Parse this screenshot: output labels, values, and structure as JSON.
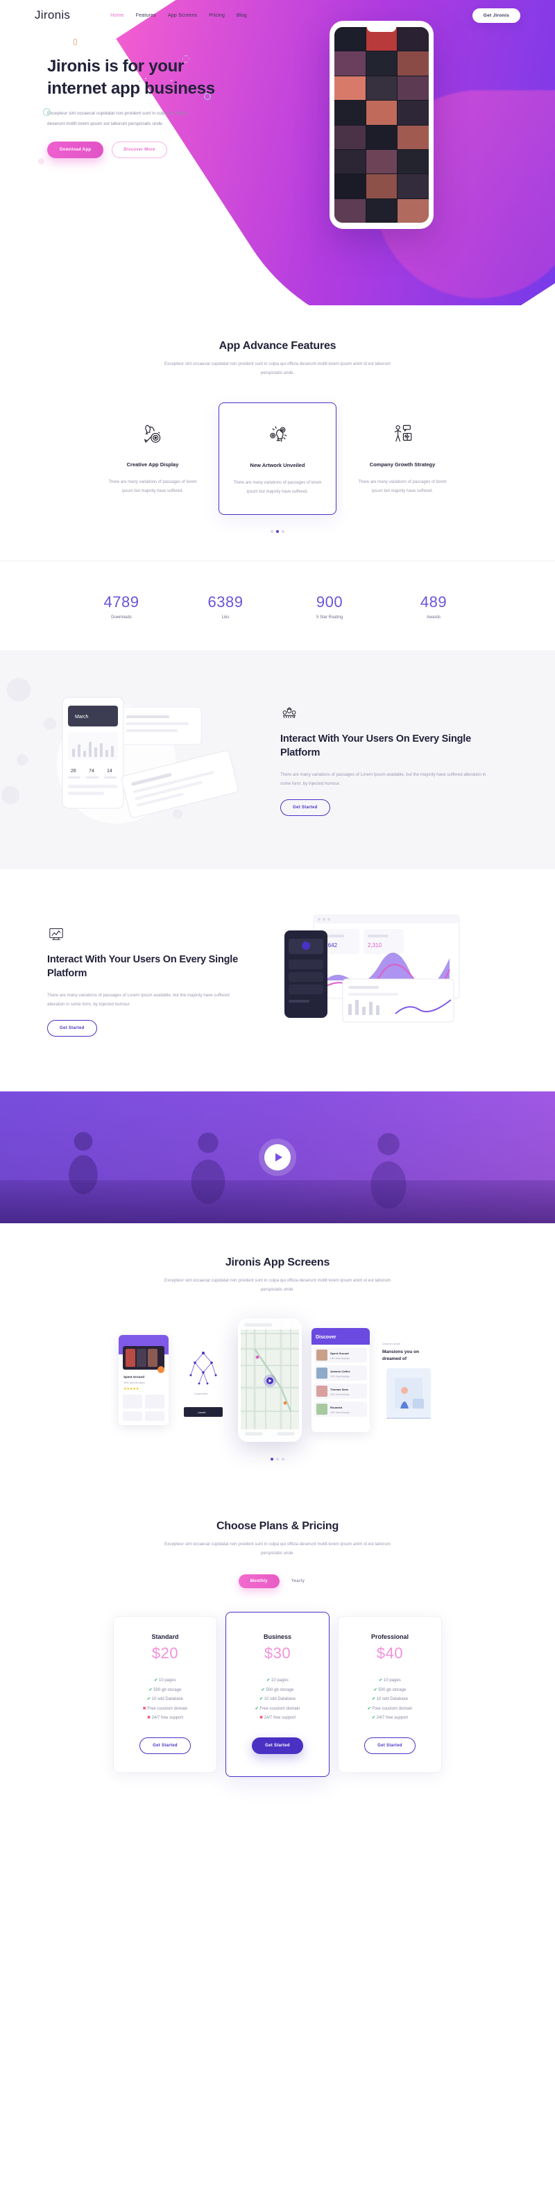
{
  "nav": {
    "brand": "Jironis",
    "links": [
      {
        "label": "Home",
        "active": true
      },
      {
        "label": "Features",
        "active": false
      },
      {
        "label": "App Screens",
        "active": false
      },
      {
        "label": "Pricing",
        "active": false
      },
      {
        "label": "Blog",
        "active": false
      }
    ],
    "cta": "Get Jironis"
  },
  "hero": {
    "heading": "Jironis is for your internet app business",
    "paragraph": "Excepteur sint occaecat cupidatat non proident sunt in culpa qui officia deserunt mollit lorem ipsum est laborum perspiciatis unde.",
    "primary_button": "Download App",
    "secondary_button": "Discover More"
  },
  "features": {
    "title": "App Advance Features",
    "subtitle": "Excepteur sint occaecat cupidatat non proident sunt in culpa qui officia deserunt mollit lorem ipsum anim id est laborum perspiciatis unde.",
    "cards": [
      {
        "icon": "creative-display-icon",
        "title": "Creative App Display",
        "text": "There are many variations of passages of lorem ipsum but majority have suffered.",
        "active": false
      },
      {
        "icon": "lightbulb-gears-icon",
        "title": "New Artwork Unveiled",
        "text": "There are many variations of passages of lorem ipsum but majority have suffered.",
        "active": true
      },
      {
        "icon": "company-growth-icon",
        "title": "Company Growth Strategy",
        "text": "There are many variations of passages of lorem ipsum but majority have suffered.",
        "active": false
      }
    ],
    "pager": {
      "count": 3,
      "active_index": 1
    }
  },
  "stats": [
    {
      "value": "4789",
      "label": "Downloads"
    },
    {
      "value": "6389",
      "label": "Liks"
    },
    {
      "value": "900",
      "label": "5 Star Roating"
    },
    {
      "value": "489",
      "label": "Awards"
    }
  ],
  "interact_grey": {
    "icon": "team-group-icon",
    "heading": "Interact With Your Users On Every Single Platform",
    "paragraph": "There are many variations of passages of Lorem Ipsum available, but the majority have suffered alteration in some form, by injected humour.",
    "button": "Get Started",
    "art": {
      "card_title": "March",
      "stat_left": "26",
      "stat_mid": "74",
      "stat_right": "14"
    }
  },
  "interact_white": {
    "icon": "analytics-board-icon",
    "heading": "Interact With Your Users On Every Single Platform",
    "paragraph": "There are many variations of passages of Lorem Ipsum available, but the majority have suffered alteration in some form, by injected humour.",
    "button": "Get Started"
  },
  "video": {
    "play_icon": "play-icon"
  },
  "app_screens": {
    "title": "Jironis App Screens",
    "subtitle": "Excepteur sint occaecat cupidatat non proident sunt in culpa qui officia deserunt mollit lorem ipsum anim id est laborum perspiciatis unde.",
    "screens": [
      {
        "name": "movie-list-screen",
        "caption": "Spent Ground"
      },
      {
        "name": "network-graph-screen",
        "caption": ""
      },
      {
        "name": "map-screen",
        "caption": ""
      },
      {
        "name": "discover-screen",
        "caption": "Discover"
      },
      {
        "name": "illustration-screen",
        "caption": "Mansions you on dreamed of"
      }
    ],
    "pager": {
      "count": 3,
      "active_index": 0
    }
  },
  "pricing": {
    "title": "Choose Plans & Pricing",
    "subtitle": "Excepteur sint occaecat cupidatat non proident sunt in culpa qui officia deserunt mollit lorem ipsum anim id est laborum perspiciatis unde.",
    "toggle": {
      "monthly": "Monthly",
      "yearly": "Yearly",
      "selected": "Monthly"
    },
    "plans": [
      {
        "name": "Standard",
        "price": "$20",
        "featured": false,
        "button": "Get Started",
        "features": [
          {
            "label": "10 pages",
            "included": true
          },
          {
            "label": "500 gb storage",
            "included": true
          },
          {
            "label": "10 sdd Database",
            "included": true
          },
          {
            "label": "Free coustom domain",
            "included": false
          },
          {
            "label": "24/7 free support",
            "included": false
          }
        ]
      },
      {
        "name": "Business",
        "price": "$30",
        "featured": true,
        "button": "Get Started",
        "features": [
          {
            "label": "10 pages",
            "included": true
          },
          {
            "label": "500 gb storage",
            "included": true
          },
          {
            "label": "10 sdd Database",
            "included": true
          },
          {
            "label": "Free coustom domain",
            "included": true
          },
          {
            "label": "24/7 free support",
            "included": false
          }
        ]
      },
      {
        "name": "Professional",
        "price": "$40",
        "featured": false,
        "button": "Get Started",
        "features": [
          {
            "label": "10 pages",
            "included": true
          },
          {
            "label": "500 gb storage",
            "included": true
          },
          {
            "label": "10 sdd Database",
            "included": true
          },
          {
            "label": "Free coustom domain",
            "included": true
          },
          {
            "label": "24/7 free support",
            "included": true
          }
        ]
      }
    ]
  },
  "colors": {
    "purple": "#4a31c4",
    "pink": "#ef5fcf",
    "heading": "#22223a",
    "muted": "#9a9ab2",
    "stat": "#6a55d8",
    "check": "#3bbd7a",
    "cross": "#ef4d6b"
  }
}
